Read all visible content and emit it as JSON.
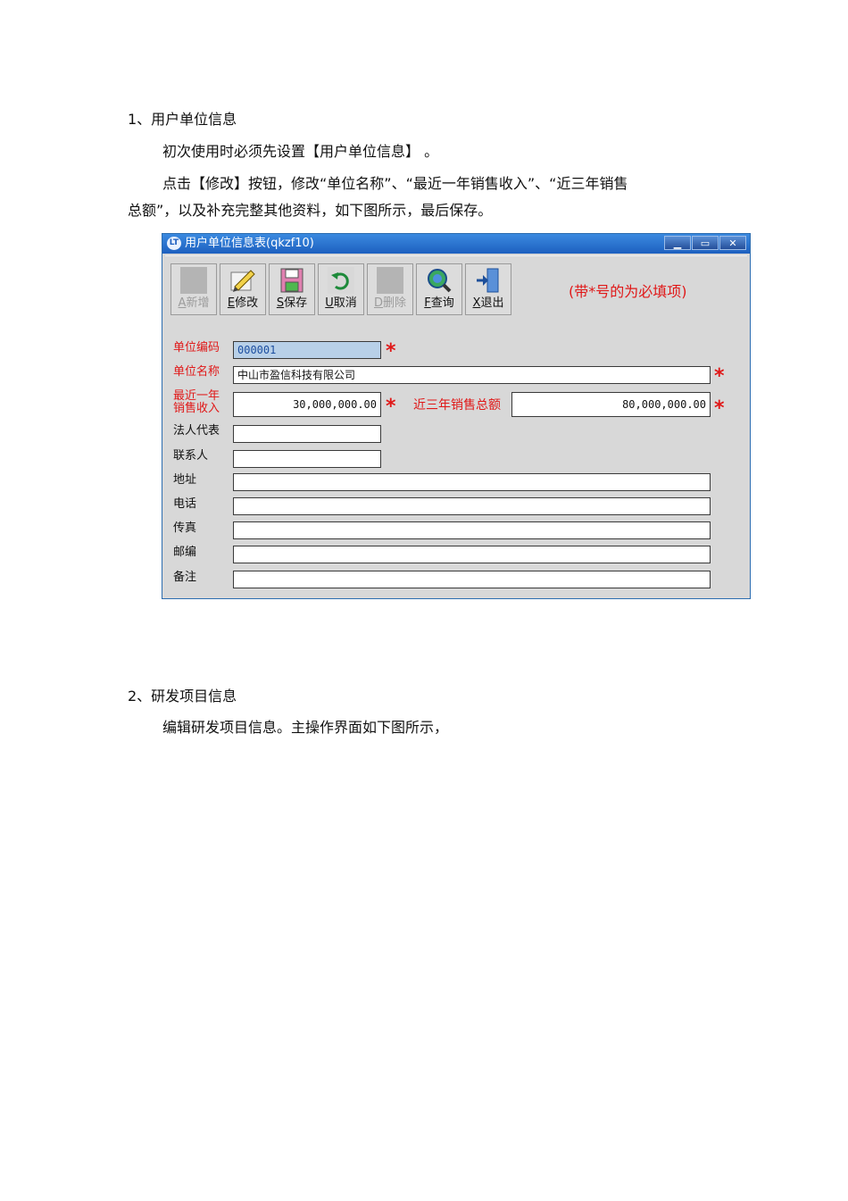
{
  "doc": {
    "s1_heading": "1、用户单位信息",
    "p1": "初次使用时必须先设置【用户单位信息】 。",
    "p2_line1": "点击【修改】按钮，修改“单位名称”、“最近一年销售收入”、“近三年销售",
    "p2_line2": "总额”，以及补充完整其他资料，如下图所示，最后保存。",
    "s2_heading": "2、研发项目信息",
    "p3": "编辑研发项目信息。主操作界面如下图所示，"
  },
  "window": {
    "title": "用户单位信息表(qkzf10)",
    "hint": "(带*号的为必填项)",
    "toolbar": [
      {
        "key": "A",
        "label": "新增",
        "disabled": true,
        "icon": "blank-icon"
      },
      {
        "key": "E",
        "label": "修改",
        "disabled": false,
        "icon": "edit-pencil-icon"
      },
      {
        "key": "S",
        "label": "保存",
        "disabled": false,
        "icon": "floppy-disk-icon"
      },
      {
        "key": "U",
        "label": "取消",
        "disabled": false,
        "icon": "undo-icon"
      },
      {
        "key": "D",
        "label": "删除",
        "disabled": true,
        "icon": "blank-icon"
      },
      {
        "key": "F",
        "label": "查询",
        "disabled": false,
        "icon": "search-globe-icon"
      },
      {
        "key": "X",
        "label": "退出",
        "disabled": false,
        "icon": "exit-door-icon"
      }
    ],
    "form": {
      "unit_code": {
        "label": "单位编码",
        "value": "000001"
      },
      "unit_name": {
        "label": "单位名称",
        "value": "中山市盈信科技有限公司"
      },
      "sales_recent": {
        "label_line1": "最近一年",
        "label_line2": "销售收入",
        "value": "30,000,000.00"
      },
      "sales_3yr": {
        "label": "近三年销售总额",
        "value": "80,000,000.00"
      },
      "legal_rep": {
        "label": "法人代表",
        "value": ""
      },
      "contact": {
        "label": "联系人",
        "value": ""
      },
      "address": {
        "label": "地址",
        "value": ""
      },
      "phone": {
        "label": "电话",
        "value": ""
      },
      "fax": {
        "label": "传真",
        "value": ""
      },
      "postcode": {
        "label": "邮编",
        "value": ""
      },
      "remark": {
        "label": "备注",
        "value": ""
      }
    },
    "required_mark": "*"
  },
  "colors": {
    "required": "#e01818",
    "titlebar": "#1d5fbf"
  }
}
